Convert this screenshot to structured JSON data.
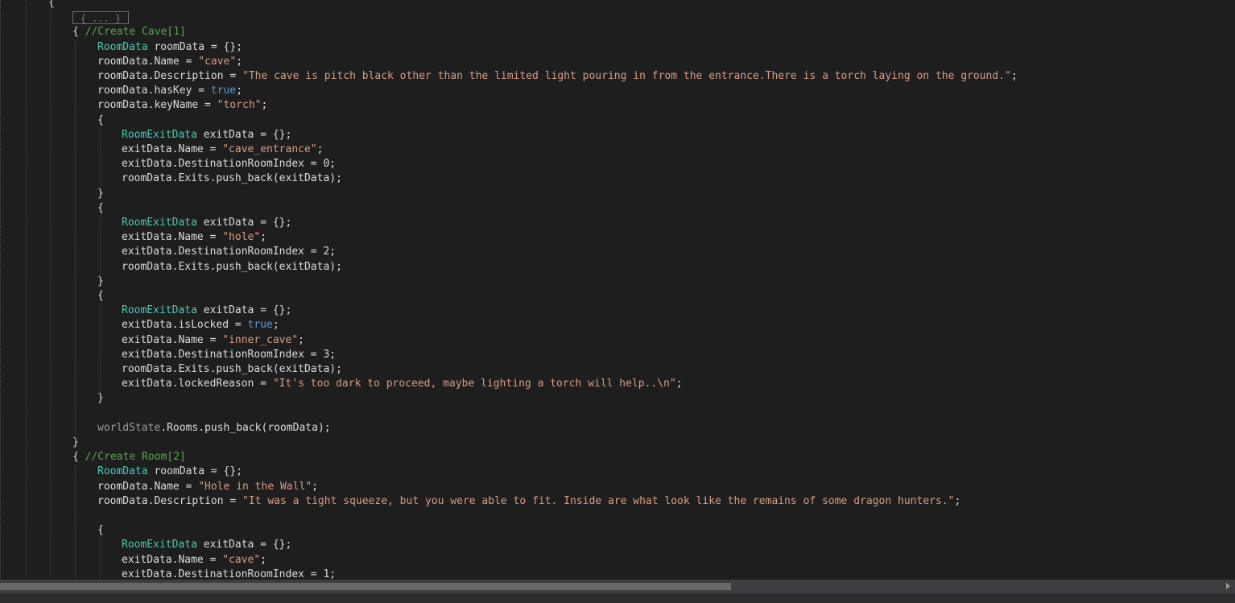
{
  "editor": {
    "fold_placeholder": "{ ... }",
    "lines": [
      {
        "indent": 0,
        "segments": [
          {
            "t": "{",
            "c": ""
          }
        ]
      },
      {
        "indent": 0,
        "segments": []
      },
      {
        "indent": 1,
        "segments": [
          {
            "t": "{ ",
            "c": ""
          },
          {
            "t": "//Create Cave[1]",
            "c": "cmt"
          }
        ]
      },
      {
        "indent": 2,
        "segments": [
          {
            "t": "RoomData",
            "c": "type"
          },
          {
            "t": " roomData = {};",
            "c": ""
          }
        ]
      },
      {
        "indent": 2,
        "segments": [
          {
            "t": "roomData.Name = ",
            "c": ""
          },
          {
            "t": "\"cave\"",
            "c": "str"
          },
          {
            "t": ";",
            "c": ""
          }
        ]
      },
      {
        "indent": 2,
        "segments": [
          {
            "t": "roomData.Description = ",
            "c": ""
          },
          {
            "t": "\"The cave is pitch black other than the limited light pouring in from the entrance.There is a torch laying on the ground.\"",
            "c": "str"
          },
          {
            "t": ";",
            "c": ""
          }
        ]
      },
      {
        "indent": 2,
        "segments": [
          {
            "t": "roomData.hasKey = ",
            "c": ""
          },
          {
            "t": "true",
            "c": "kw"
          },
          {
            "t": ";",
            "c": ""
          }
        ]
      },
      {
        "indent": 2,
        "segments": [
          {
            "t": "roomData.keyName = ",
            "c": ""
          },
          {
            "t": "\"torch\"",
            "c": "str"
          },
          {
            "t": ";",
            "c": ""
          }
        ]
      },
      {
        "indent": 2,
        "segments": [
          {
            "t": "{",
            "c": ""
          }
        ]
      },
      {
        "indent": 3,
        "segments": [
          {
            "t": "RoomExitData",
            "c": "type"
          },
          {
            "t": " exitData = {};",
            "c": ""
          }
        ]
      },
      {
        "indent": 3,
        "segments": [
          {
            "t": "exitData.Name = ",
            "c": ""
          },
          {
            "t": "\"cave_entrance\"",
            "c": "str"
          },
          {
            "t": ";",
            "c": ""
          }
        ]
      },
      {
        "indent": 3,
        "segments": [
          {
            "t": "exitData.DestinationRoomIndex = ",
            "c": ""
          },
          {
            "t": "0",
            "c": ""
          },
          {
            "t": ";",
            "c": ""
          }
        ]
      },
      {
        "indent": 3,
        "segments": [
          {
            "t": "roomData.Exits.push_back(exitData);",
            "c": ""
          }
        ]
      },
      {
        "indent": 2,
        "segments": [
          {
            "t": "}",
            "c": ""
          }
        ]
      },
      {
        "indent": 2,
        "segments": [
          {
            "t": "{",
            "c": ""
          }
        ]
      },
      {
        "indent": 3,
        "segments": [
          {
            "t": "RoomExitData",
            "c": "type"
          },
          {
            "t": " exitData = {};",
            "c": ""
          }
        ]
      },
      {
        "indent": 3,
        "segments": [
          {
            "t": "exitData.Name = ",
            "c": ""
          },
          {
            "t": "\"hole\"",
            "c": "str"
          },
          {
            "t": ";",
            "c": ""
          }
        ]
      },
      {
        "indent": 3,
        "segments": [
          {
            "t": "exitData.DestinationRoomIndex = ",
            "c": ""
          },
          {
            "t": "2",
            "c": ""
          },
          {
            "t": ";",
            "c": ""
          }
        ]
      },
      {
        "indent": 3,
        "segments": [
          {
            "t": "roomData.Exits.push_back(exitData);",
            "c": ""
          }
        ]
      },
      {
        "indent": 2,
        "segments": [
          {
            "t": "}",
            "c": ""
          }
        ]
      },
      {
        "indent": 2,
        "segments": [
          {
            "t": "{",
            "c": ""
          }
        ]
      },
      {
        "indent": 3,
        "segments": [
          {
            "t": "RoomExitData",
            "c": "type"
          },
          {
            "t": " exitData = {};",
            "c": ""
          }
        ]
      },
      {
        "indent": 3,
        "segments": [
          {
            "t": "exitData.isLocked = ",
            "c": ""
          },
          {
            "t": "true",
            "c": "kw"
          },
          {
            "t": ";",
            "c": ""
          }
        ]
      },
      {
        "indent": 3,
        "segments": [
          {
            "t": "exitData.Name = ",
            "c": ""
          },
          {
            "t": "\"inner_cave\"",
            "c": "str"
          },
          {
            "t": ";",
            "c": ""
          }
        ]
      },
      {
        "indent": 3,
        "segments": [
          {
            "t": "exitData.DestinationRoomIndex = ",
            "c": ""
          },
          {
            "t": "3",
            "c": ""
          },
          {
            "t": ";",
            "c": ""
          }
        ]
      },
      {
        "indent": 3,
        "segments": [
          {
            "t": "roomData.Exits.push_back(exitData);",
            "c": ""
          }
        ]
      },
      {
        "indent": 3,
        "segments": [
          {
            "t": "exitData.lockedReason = ",
            "c": ""
          },
          {
            "t": "\"It's too dark to proceed, maybe lighting a torch will help..\\n\"",
            "c": "str"
          },
          {
            "t": ";",
            "c": ""
          }
        ]
      },
      {
        "indent": 2,
        "segments": [
          {
            "t": "}",
            "c": ""
          }
        ]
      },
      {
        "indent": 2,
        "segments": []
      },
      {
        "indent": 2,
        "segments": [
          {
            "t": "worldState",
            "c": "dim"
          },
          {
            "t": ".Rooms.push_back(roomData);",
            "c": ""
          }
        ]
      },
      {
        "indent": 1,
        "segments": [
          {
            "t": "}",
            "c": ""
          }
        ]
      },
      {
        "indent": 1,
        "segments": [
          {
            "t": "{ ",
            "c": ""
          },
          {
            "t": "//Create Room[2]",
            "c": "cmt"
          }
        ]
      },
      {
        "indent": 2,
        "segments": [
          {
            "t": "RoomData",
            "c": "type"
          },
          {
            "t": " roomData = {};",
            "c": ""
          }
        ]
      },
      {
        "indent": 2,
        "segments": [
          {
            "t": "roomData.Name = ",
            "c": ""
          },
          {
            "t": "\"Hole in the Wall\"",
            "c": "str"
          },
          {
            "t": ";",
            "c": ""
          }
        ]
      },
      {
        "indent": 2,
        "segments": [
          {
            "t": "roomData.Description = ",
            "c": ""
          },
          {
            "t": "\"It was a tight squeeze, but you were able to fit. Inside are what look like the remains of some dragon hunters.\"",
            "c": "str"
          },
          {
            "t": ";",
            "c": ""
          }
        ]
      },
      {
        "indent": 2,
        "segments": []
      },
      {
        "indent": 2,
        "segments": [
          {
            "t": "{",
            "c": ""
          }
        ]
      },
      {
        "indent": 3,
        "segments": [
          {
            "t": "RoomExitData",
            "c": "type"
          },
          {
            "t": " exitData = {};",
            "c": ""
          }
        ]
      },
      {
        "indent": 3,
        "segments": [
          {
            "t": "exitData.Name = ",
            "c": ""
          },
          {
            "t": "\"cave\"",
            "c": "str"
          },
          {
            "t": ";",
            "c": ""
          }
        ]
      },
      {
        "indent": 3,
        "segments": [
          {
            "t": "exitData.DestinationRoomIndex = ",
            "c": ""
          },
          {
            "t": "1",
            "c": ""
          },
          {
            "t": ";",
            "c": ""
          }
        ]
      }
    ]
  },
  "scrollbar": {
    "horizontal_position_fraction": 0.0,
    "horizontal_visible_fraction": 0.6
  }
}
